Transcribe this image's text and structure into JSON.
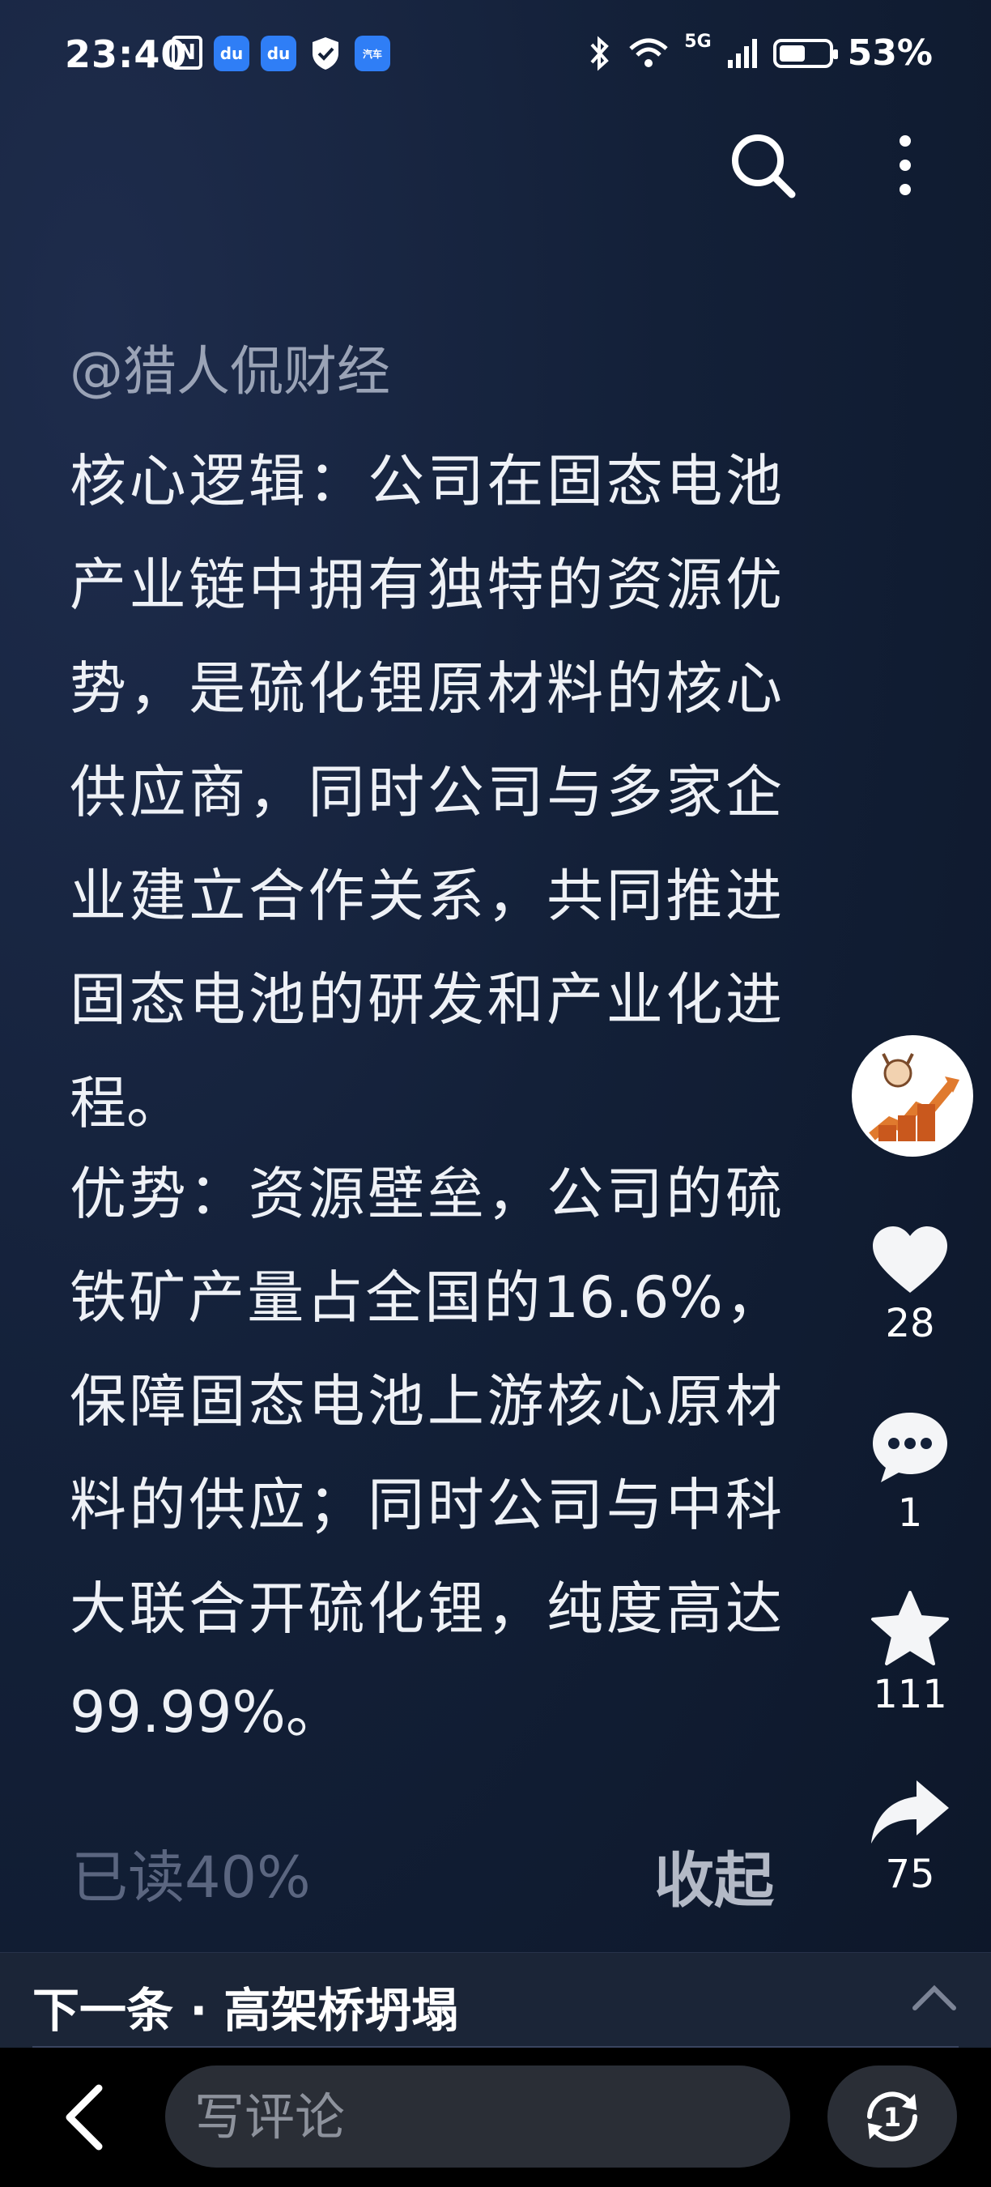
{
  "status_bar": {
    "time": "23:40",
    "app_icons": [
      "nfc-icon",
      "baidu-icon",
      "baidu-icon",
      "shield-icon",
      "autohome-icon"
    ],
    "signal_label": "5G",
    "battery": "53%",
    "battery_level": 0.53
  },
  "post": {
    "author": "@猎人侃财经",
    "paragraph_1": "核心逻辑：公司在固态电池产业链中拥有独特的资源优势，是硫化锂原材料的核心供应商，同时公司与多家企业建立合作关系，共同推进固态电池的研发和产业化进程。",
    "paragraph_2": "优势：资源壁垒，公司的硫铁矿产量占全国的16.6%，保障固态电池上游核心原材料的供应；同时公司与中科大联合开硫化锂，纯度高达99.99%。",
    "read_progress": "已读40%",
    "collapse_label": "收起"
  },
  "actions": {
    "likes": "28",
    "comments": "1",
    "favorites": "111",
    "shares": "75"
  },
  "next": {
    "label": "下一条 · 高架桥坍塌"
  },
  "bottom_bar": {
    "comment_placeholder": "写评论",
    "sync_badge": "1"
  }
}
